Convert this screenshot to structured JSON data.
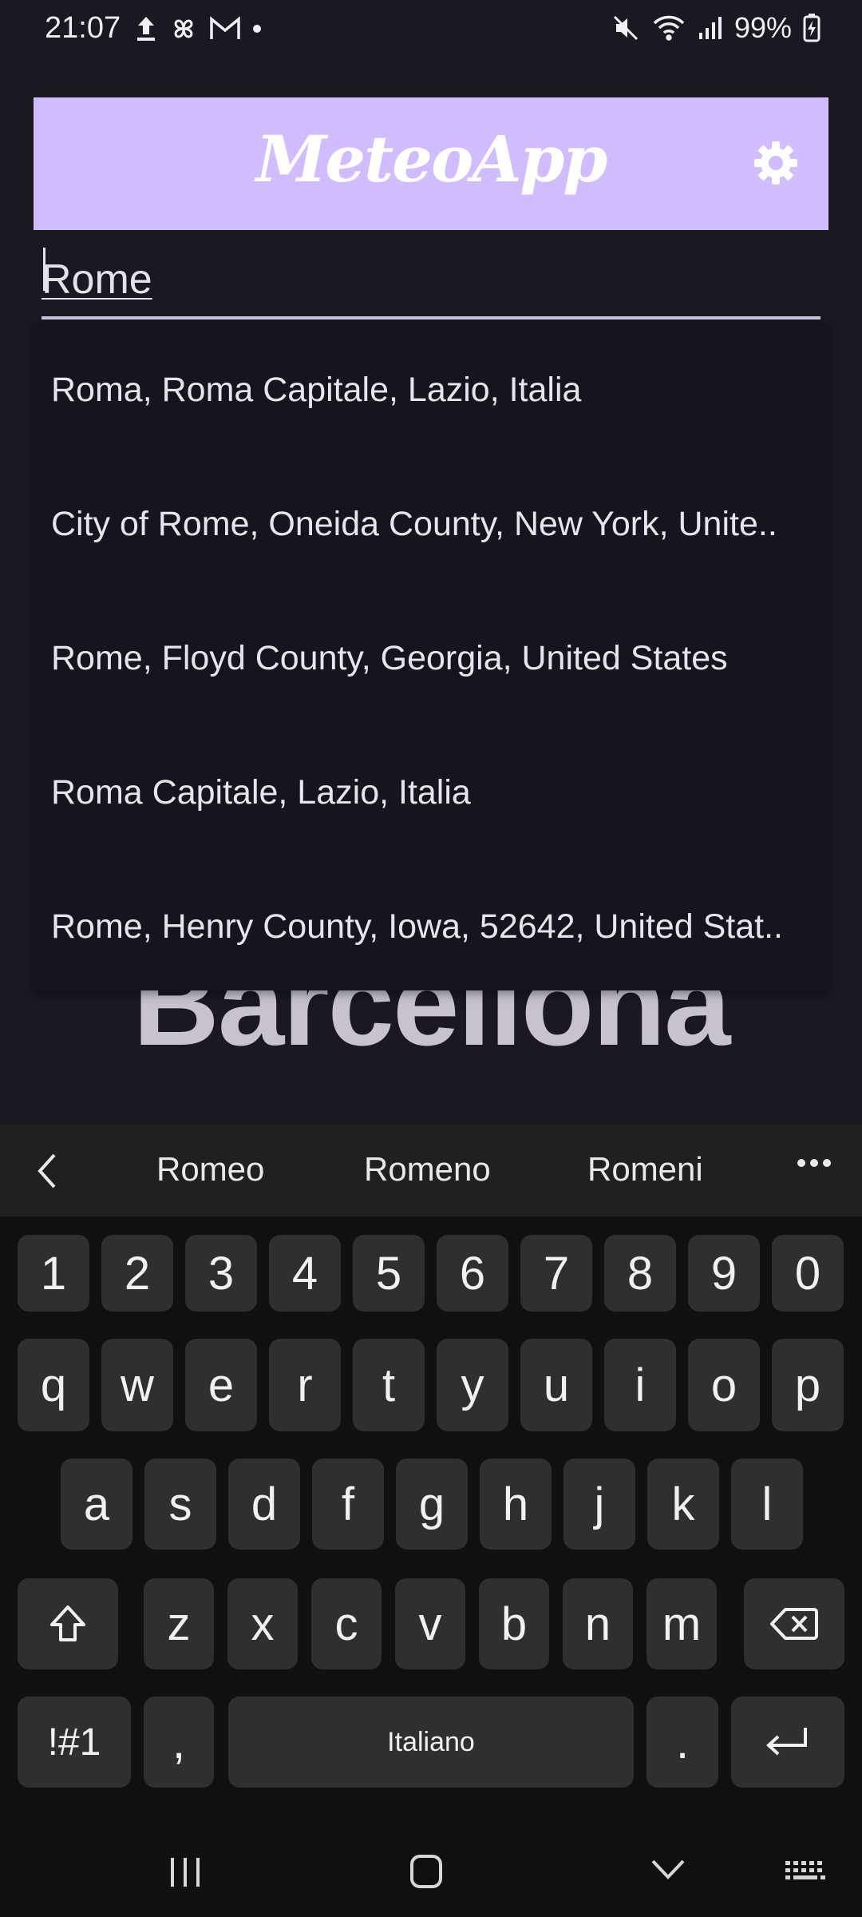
{
  "status_bar": {
    "time": "21:07",
    "battery": "99%"
  },
  "app_bar": {
    "title": "MeteoApp"
  },
  "search": {
    "value": "Rome"
  },
  "suggestions": [
    "Roma, Roma Capitale, Lazio, Italia",
    "City of Rome, Oneida County, New York, Unite..",
    "Rome, Floyd County, Georgia, United States",
    "Roma Capitale, Lazio, Italia",
    "Rome, Henry County, Iowa, 52642, United Stat.."
  ],
  "background_city": "Barcellona",
  "keyboard": {
    "word_suggestions": [
      "Romeo",
      "Romeno",
      "Romeni"
    ],
    "row_numbers": [
      "1",
      "2",
      "3",
      "4",
      "5",
      "6",
      "7",
      "8",
      "9",
      "0"
    ],
    "row_qwerty": [
      "q",
      "w",
      "e",
      "r",
      "t",
      "y",
      "u",
      "i",
      "o",
      "p"
    ],
    "row_asdf": [
      "a",
      "s",
      "d",
      "f",
      "g",
      "h",
      "j",
      "k",
      "l"
    ],
    "row_zxcv": [
      "z",
      "x",
      "c",
      "v",
      "b",
      "n",
      "m"
    ],
    "symbols_label": "!#1",
    "comma_label": ",",
    "space_label": "Italiano",
    "period_label": "."
  },
  "colors": {
    "app_bar_bg": "#d0bcff",
    "background": "#1a1820",
    "keyboard_bg": "#101012",
    "key_bg": "#2f2f31"
  }
}
